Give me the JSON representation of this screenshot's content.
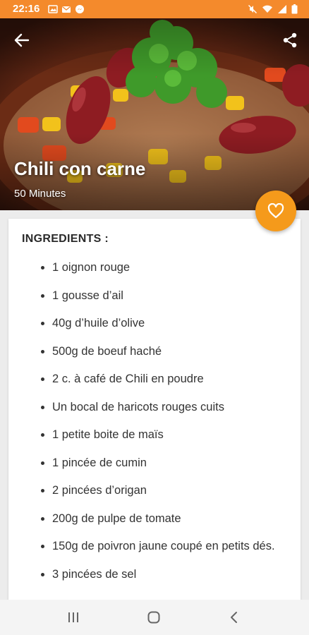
{
  "status_bar": {
    "time": "22:16",
    "left_icons": [
      "image-icon",
      "mail-icon",
      "messenger-icon"
    ],
    "right_icons": [
      "mute-icon",
      "wifi-icon",
      "signal-icon",
      "battery-icon"
    ],
    "color": "#f48a2c"
  },
  "header": {
    "back_icon": "arrow-back-icon",
    "share_icon": "share-icon"
  },
  "recipe": {
    "title": "Chili con carne",
    "duration": "50 Minutes"
  },
  "favorite": {
    "icon": "heart-icon",
    "color": "#f59a1b"
  },
  "ingredients": {
    "heading": "INGREDIENTS :",
    "items": [
      "1 oignon rouge",
      "1 gousse d’ail",
      "40g d’huile d’olive",
      "500g de boeuf haché",
      "2 c. à café de Chili en poudre",
      "Un bocal de haricots rouges cuits",
      "1 petite boite de maïs",
      "1 pincée de cumin",
      "2 pincées d’origan",
      "200g de pulpe de tomate",
      "150g de poivron jaune coupé en petits dés.",
      "3 pincées de sel"
    ]
  },
  "nav_bar": {
    "recents_icon": "recents-icon",
    "home_icon": "home-icon",
    "back_icon": "nav-back-icon"
  }
}
